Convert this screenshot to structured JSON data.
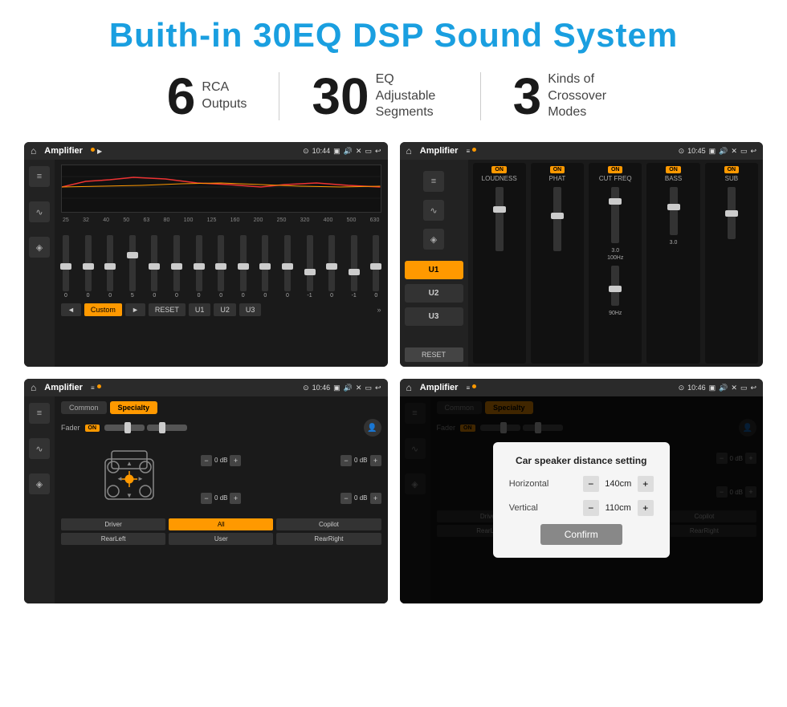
{
  "page": {
    "title": "Buith-in 30EQ DSP Sound System",
    "stats": [
      {
        "number": "6",
        "text": "RCA\nOutputs"
      },
      {
        "number": "30",
        "text": "EQ Adjustable\nSegments"
      },
      {
        "number": "3",
        "text": "Kinds of\nCrossover Modes"
      }
    ]
  },
  "screens": [
    {
      "id": "screen1",
      "status": {
        "app": "Amplifier",
        "time": "10:44"
      },
      "type": "equalizer",
      "freqs": [
        "25",
        "32",
        "40",
        "50",
        "63",
        "80",
        "100",
        "125",
        "160",
        "200",
        "250",
        "320",
        "400",
        "500",
        "630"
      ],
      "values": [
        "0",
        "0",
        "0",
        "5",
        "0",
        "0",
        "0",
        "0",
        "0",
        "0",
        "0",
        "-1",
        "0",
        "-1"
      ],
      "preset": "Custom",
      "buttons": [
        "RESET",
        "U1",
        "U2",
        "U3"
      ]
    },
    {
      "id": "screen2",
      "status": {
        "app": "Amplifier",
        "time": "10:45"
      },
      "type": "amplifier",
      "presets": [
        "U1",
        "U2",
        "U3"
      ],
      "channels": [
        {
          "name": "LOUDNESS",
          "on": true
        },
        {
          "name": "PHAT",
          "on": true
        },
        {
          "name": "CUT FREQ",
          "on": true
        },
        {
          "name": "BASS",
          "on": true
        },
        {
          "name": "SUB",
          "on": true
        }
      ],
      "resetBtn": "RESET"
    },
    {
      "id": "screen3",
      "status": {
        "app": "Amplifier",
        "time": "10:46"
      },
      "type": "speaker",
      "tabs": [
        "Common",
        "Specialty"
      ],
      "activeTab": "Specialty",
      "faderLabel": "Fader",
      "faderOn": "ON",
      "volumes": [
        "0 dB",
        "0 dB",
        "0 dB",
        "0 dB"
      ],
      "buttons": [
        "Driver",
        "",
        "Copilot",
        "RearLeft",
        "All",
        "User",
        "RearRight"
      ]
    },
    {
      "id": "screen4",
      "status": {
        "app": "Amplifier",
        "time": "10:46"
      },
      "type": "speaker-dialog",
      "tabs": [
        "Common",
        "Specialty"
      ],
      "activeTab": "Specialty",
      "dialog": {
        "title": "Car speaker distance setting",
        "horizontal": {
          "label": "Horizontal",
          "value": "140cm"
        },
        "vertical": {
          "label": "Vertical",
          "value": "110cm"
        },
        "confirmBtn": "Confirm"
      },
      "volumes": [
        "0 dB",
        "0 dB"
      ],
      "buttons": [
        "Driver",
        "",
        "Copilot",
        "RearLeft",
        "",
        "",
        "RearRight"
      ]
    }
  ],
  "icons": {
    "home": "⌂",
    "back": "↩",
    "location": "⊙",
    "camera": "📷",
    "volume": "🔊",
    "close": "✕",
    "window": "▭",
    "equalizer": "≡≡",
    "waveform": "∿",
    "speaker": "◈",
    "plus": "+",
    "minus": "−",
    "prev": "◄",
    "next": "►",
    "chevron-down": "▼",
    "chevron-up": "▲",
    "user": "👤"
  }
}
